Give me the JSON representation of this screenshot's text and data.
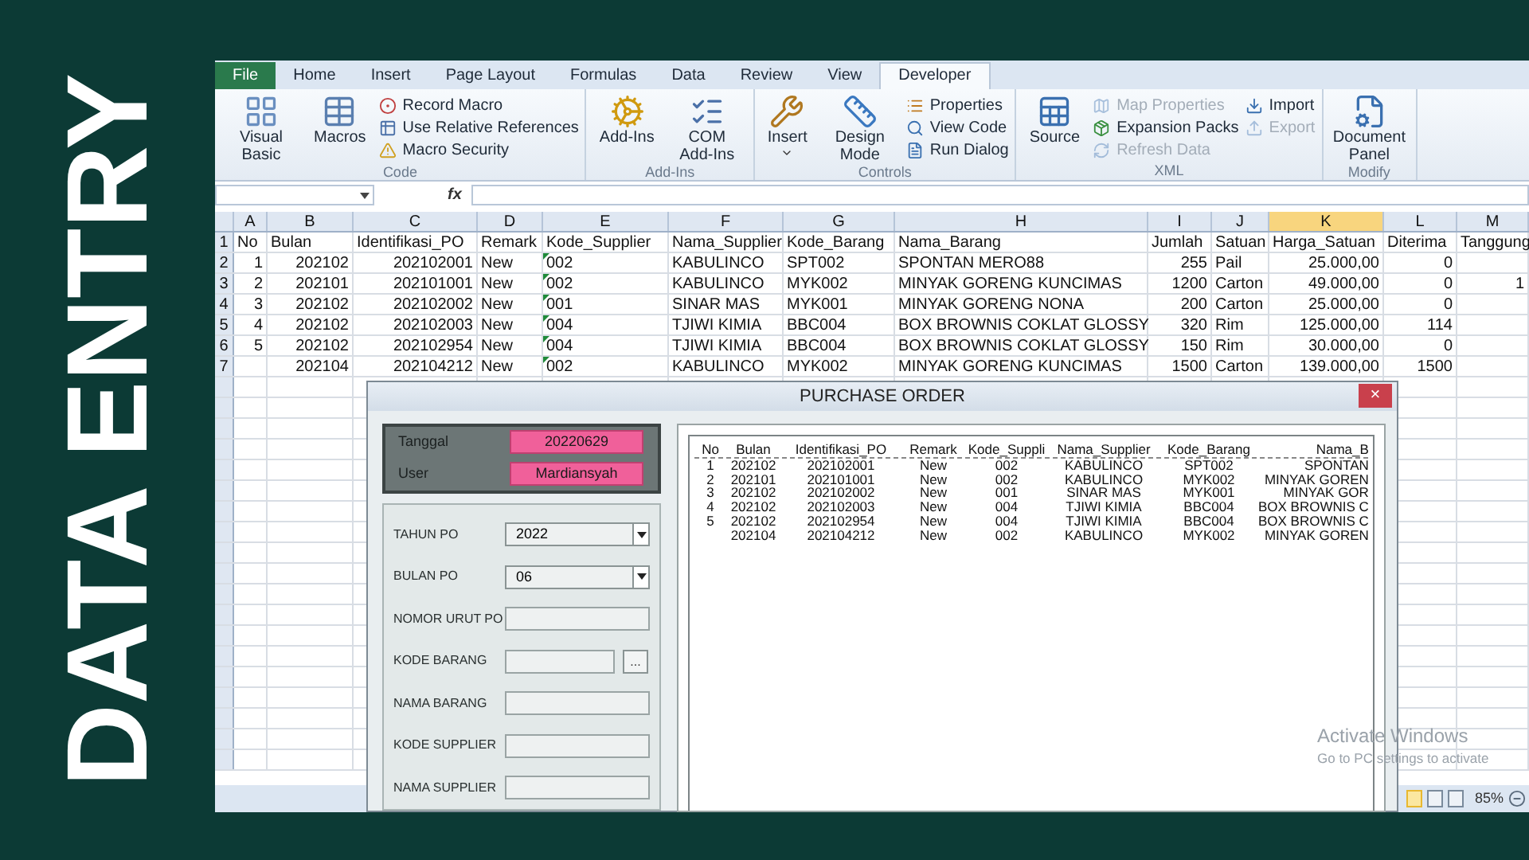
{
  "banner_title": "DATA ENTRY",
  "ribbon": {
    "tabs": [
      {
        "label": "File",
        "kind": "file",
        "selected": false
      },
      {
        "label": "Home",
        "kind": "tab",
        "selected": false
      },
      {
        "label": "Insert",
        "kind": "tab",
        "selected": false
      },
      {
        "label": "Page Layout",
        "kind": "tab",
        "selected": false
      },
      {
        "label": "Formulas",
        "kind": "tab",
        "selected": false
      },
      {
        "label": "Data",
        "kind": "tab",
        "selected": false
      },
      {
        "label": "Review",
        "kind": "tab",
        "selected": false
      },
      {
        "label": "View",
        "kind": "tab",
        "selected": false
      },
      {
        "label": "Developer",
        "kind": "tab",
        "selected": true
      }
    ],
    "groups": [
      {
        "label": "Code",
        "items": [
          {
            "label": "Visual Basic",
            "kind": "large",
            "disabled": false
          },
          {
            "label": "Macros",
            "kind": "large",
            "disabled": false
          },
          {
            "label": "Record Macro",
            "kind": "small",
            "disabled": false
          },
          {
            "label": "Use Relative References",
            "kind": "small",
            "disabled": false
          },
          {
            "label": "Macro Security",
            "kind": "small",
            "disabled": false
          }
        ]
      },
      {
        "label": "Add-Ins",
        "items": [
          {
            "label": "Add-Ins",
            "kind": "large",
            "disabled": false
          },
          {
            "label": "COM Add-Ins",
            "kind": "large",
            "disabled": false
          }
        ]
      },
      {
        "label": "Controls",
        "items": [
          {
            "label": "Insert",
            "kind": "large-dropdown",
            "disabled": false
          },
          {
            "label": "Design Mode",
            "kind": "large",
            "disabled": false
          },
          {
            "label": "Properties",
            "kind": "small",
            "disabled": false
          },
          {
            "label": "View Code",
            "kind": "small",
            "disabled": false
          },
          {
            "label": "Run Dialog",
            "kind": "small",
            "disabled": false
          }
        ]
      },
      {
        "label": "XML",
        "items": [
          {
            "label": "Source",
            "kind": "large",
            "disabled": false
          },
          {
            "label": "Map Properties",
            "kind": "small",
            "disabled": true
          },
          {
            "label": "Expansion Packs",
            "kind": "small",
            "disabled": false
          },
          {
            "label": "Refresh Data",
            "kind": "small",
            "disabled": true
          },
          {
            "label": "Import",
            "kind": "small",
            "disabled": false
          },
          {
            "label": "Export",
            "kind": "small",
            "disabled": true
          }
        ]
      },
      {
        "label": "Modify",
        "items": [
          {
            "label": "Document Panel",
            "kind": "large",
            "disabled": false
          }
        ]
      }
    ]
  },
  "formula_bar": {
    "function_label": "fx"
  },
  "sheet": {
    "columns": [
      {
        "letter": "A",
        "selected": false,
        "flagged": false
      },
      {
        "letter": "B",
        "selected": false,
        "flagged": false
      },
      {
        "letter": "C",
        "selected": false,
        "flagged": false
      },
      {
        "letter": "D",
        "selected": false,
        "flagged": false
      },
      {
        "letter": "E",
        "selected": false,
        "flagged": true
      },
      {
        "letter": "F",
        "selected": false,
        "flagged": false
      },
      {
        "letter": "G",
        "selected": false,
        "flagged": false
      },
      {
        "letter": "H",
        "selected": false,
        "flagged": false
      },
      {
        "letter": "I",
        "selected": false,
        "flagged": false
      },
      {
        "letter": "J",
        "selected": false,
        "flagged": false
      },
      {
        "letter": "K",
        "selected": true,
        "flagged": false
      },
      {
        "letter": "L",
        "selected": false,
        "flagged": false
      },
      {
        "letter": "M",
        "selected": false,
        "flagged": false
      }
    ],
    "rows": [
      {
        "number": "1",
        "cells": [
          "No",
          "Bulan",
          "Identifikasi_PO",
          "Remark",
          "Kode_Supplier",
          "Nama_Supplier",
          "Kode_Barang",
          "Nama_Barang",
          "Jumlah",
          "Satuan",
          "Harga_Satuan",
          "Diterima",
          "Tanggung"
        ]
      },
      {
        "number": "2",
        "cells": [
          "1",
          "202102",
          "202102001",
          "New",
          "002",
          "KABULINCO",
          "SPT002",
          "SPONTAN MERO88",
          "255",
          "Pail",
          "25.000,00",
          "0",
          null
        ]
      },
      {
        "number": "3",
        "cells": [
          "2",
          "202101",
          "202101001",
          "New",
          "002",
          "KABULINCO",
          "MYK002",
          "MINYAK GORENG KUNCIMAS",
          "1200",
          "Carton",
          "49.000,00",
          "0",
          "1"
        ]
      },
      {
        "number": "4",
        "cells": [
          "3",
          "202102",
          "202102002",
          "New",
          "001",
          "SINAR MAS",
          "MYK001",
          "MINYAK GORENG NONA",
          "200",
          "Carton",
          "25.000,00",
          "0",
          null
        ]
      },
      {
        "number": "5",
        "cells": [
          "4",
          "202102",
          "202102003",
          "New",
          "004",
          "TJIWI KIMIA",
          "BBC004",
          "BOX BROWNIS COKLAT GLOSSY",
          "320",
          "Rim",
          "125.000,00",
          "114",
          null
        ]
      },
      {
        "number": "6",
        "cells": [
          "5",
          "202102",
          "202102954",
          "New",
          "004",
          "TJIWI KIMIA",
          "BBC004",
          "BOX BROWNIS COKLAT GLOSSY",
          "150",
          "Rim",
          "30.000,00",
          "0",
          null
        ]
      },
      {
        "number": "7",
        "cells": [
          null,
          "202104",
          "202104212",
          "New",
          "002",
          "KABULINCO",
          "MYK002",
          "MINYAK GORENG KUNCIMAS",
          "1500",
          "Carton",
          "139.000,00",
          "1500",
          null
        ]
      }
    ]
  },
  "form": {
    "title": "PURCHASE ORDER",
    "close": "×",
    "info": [
      {
        "label": "Tanggal",
        "value": "20220629"
      },
      {
        "label": "User",
        "value": "Mardiansyah"
      }
    ],
    "fields": [
      {
        "label": "TAHUN PO",
        "kind": "combo",
        "value": "2022"
      },
      {
        "label": "BULAN PO",
        "kind": "combo",
        "value": "06"
      },
      {
        "label": "NOMOR URUT PO",
        "kind": "text"
      },
      {
        "label": "KODE BARANG",
        "kind": "lookup",
        "button": "..."
      },
      {
        "label": "NAMA BARANG",
        "kind": "text"
      },
      {
        "label": "KODE SUPPLIER",
        "kind": "text"
      },
      {
        "label": "NAMA SUPPLIER",
        "kind": "text"
      }
    ],
    "list": {
      "columns": [
        "No",
        "Bulan",
        "Identifikasi_PO",
        "Remark",
        "Kode_Suppli",
        "Nama_Supplier",
        "Kode_Barang",
        "Nama_B"
      ],
      "rows": [
        [
          "1",
          "202102",
          "202102001",
          "New",
          "002",
          "KABULINCO",
          "SPT002",
          "SPONTAN"
        ],
        [
          "2",
          "202101",
          "202101001",
          "New",
          "002",
          "KABULINCO",
          "MYK002",
          "MINYAK GOREN"
        ],
        [
          "3",
          "202102",
          "202102002",
          "New",
          "001",
          "SINAR MAS",
          "MYK001",
          "MINYAK GOR"
        ],
        [
          "4",
          "202102",
          "202102003",
          "New",
          "004",
          "TJIWI KIMIA",
          "BBC004",
          "BOX BROWNIS C"
        ],
        [
          "5",
          "202102",
          "202102954",
          "New",
          "004",
          "TJIWI KIMIA",
          "BBC004",
          "BOX BROWNIS C"
        ],
        [
          null,
          "202104",
          "202104212",
          "New",
          "002",
          "KABULINCO",
          "MYK002",
          "MINYAK GOREN"
        ]
      ]
    }
  },
  "activation_notice": [
    "Activate Windows",
    "Go to PC settings to activate"
  ],
  "status_bar": {
    "views": [
      {
        "selected": true
      },
      {
        "selected": false
      },
      {
        "selected": false
      }
    ],
    "zoom": "85%"
  }
}
